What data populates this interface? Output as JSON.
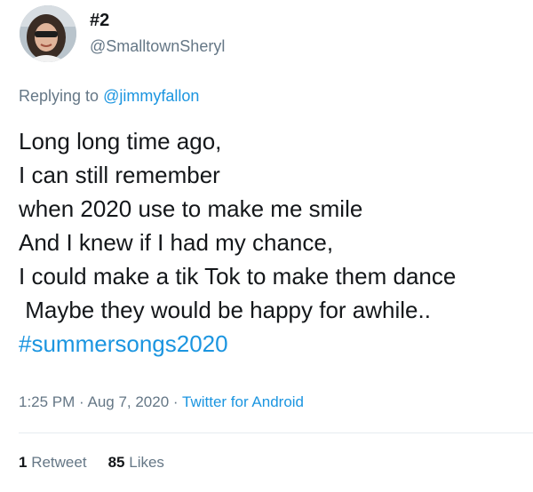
{
  "tweet": {
    "display_name": "#2",
    "handle": "@SmalltownSheryl",
    "replying_prefix": "Replying to ",
    "replying_mention": "@jimmyfallon",
    "lines": [
      "Long long time ago,",
      "I can still remember",
      "when 2020 use to make me smile",
      "And I knew if I had my chance,",
      "I could make a tik Tok to make them dance",
      " Maybe they would be happy for awhile.."
    ],
    "hashtag": "#summersongs2020",
    "time": "1:25 PM",
    "sep": " · ",
    "date": "Aug 7, 2020",
    "source": "Twitter for Android",
    "retweets_count": "1",
    "retweets_label": "Retweet",
    "likes_count": "85",
    "likes_label": "Likes"
  },
  "colors": {
    "link": "#1b95e0",
    "secondary_text": "#657786",
    "primary_text": "#14171a",
    "divider": "#e6ecf0"
  },
  "icons": {
    "avatar": "profile-photo"
  }
}
